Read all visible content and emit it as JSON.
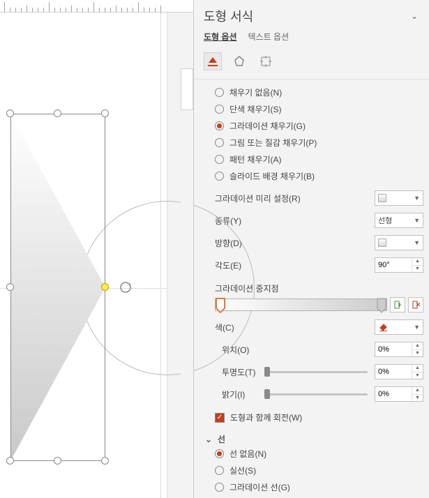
{
  "panel": {
    "title": "도형 서식",
    "tabs": {
      "shape_options": "도형 옵션",
      "text_options": "텍스트 옵션"
    }
  },
  "fill": {
    "none": "채우기 없음(N)",
    "solid": "단색 채우기(S)",
    "gradient": "그라데이션 채우기(G)",
    "picture": "그림 또는 질감 채우기(P)",
    "pattern": "패턴 채우기(A)",
    "slidebg": "슬라이드 배경 채우기(B)"
  },
  "grad": {
    "preset_label": "그라데이션 미리 설정(R)",
    "type_label": "종류(Y)",
    "type_value": "선형",
    "dir_label": "방향(D)",
    "angle_label": "각도(E)",
    "angle_value": "90°",
    "stops_label": "그라데이션 중지점",
    "color_label": "색(C)",
    "position_label": "위치(O)",
    "position_value": "0%",
    "transparency_label": "투명도(T)",
    "transparency_value": "0%",
    "brightness_label": "밝기(I)",
    "brightness_value": "0%",
    "rotate_check": "도형과 함께 회전(W)"
  },
  "line": {
    "heading": "선",
    "none": "선 없음(N)",
    "solid": "실선(S)",
    "gradient": "그라데이션 선(G)"
  },
  "chart_data": null
}
